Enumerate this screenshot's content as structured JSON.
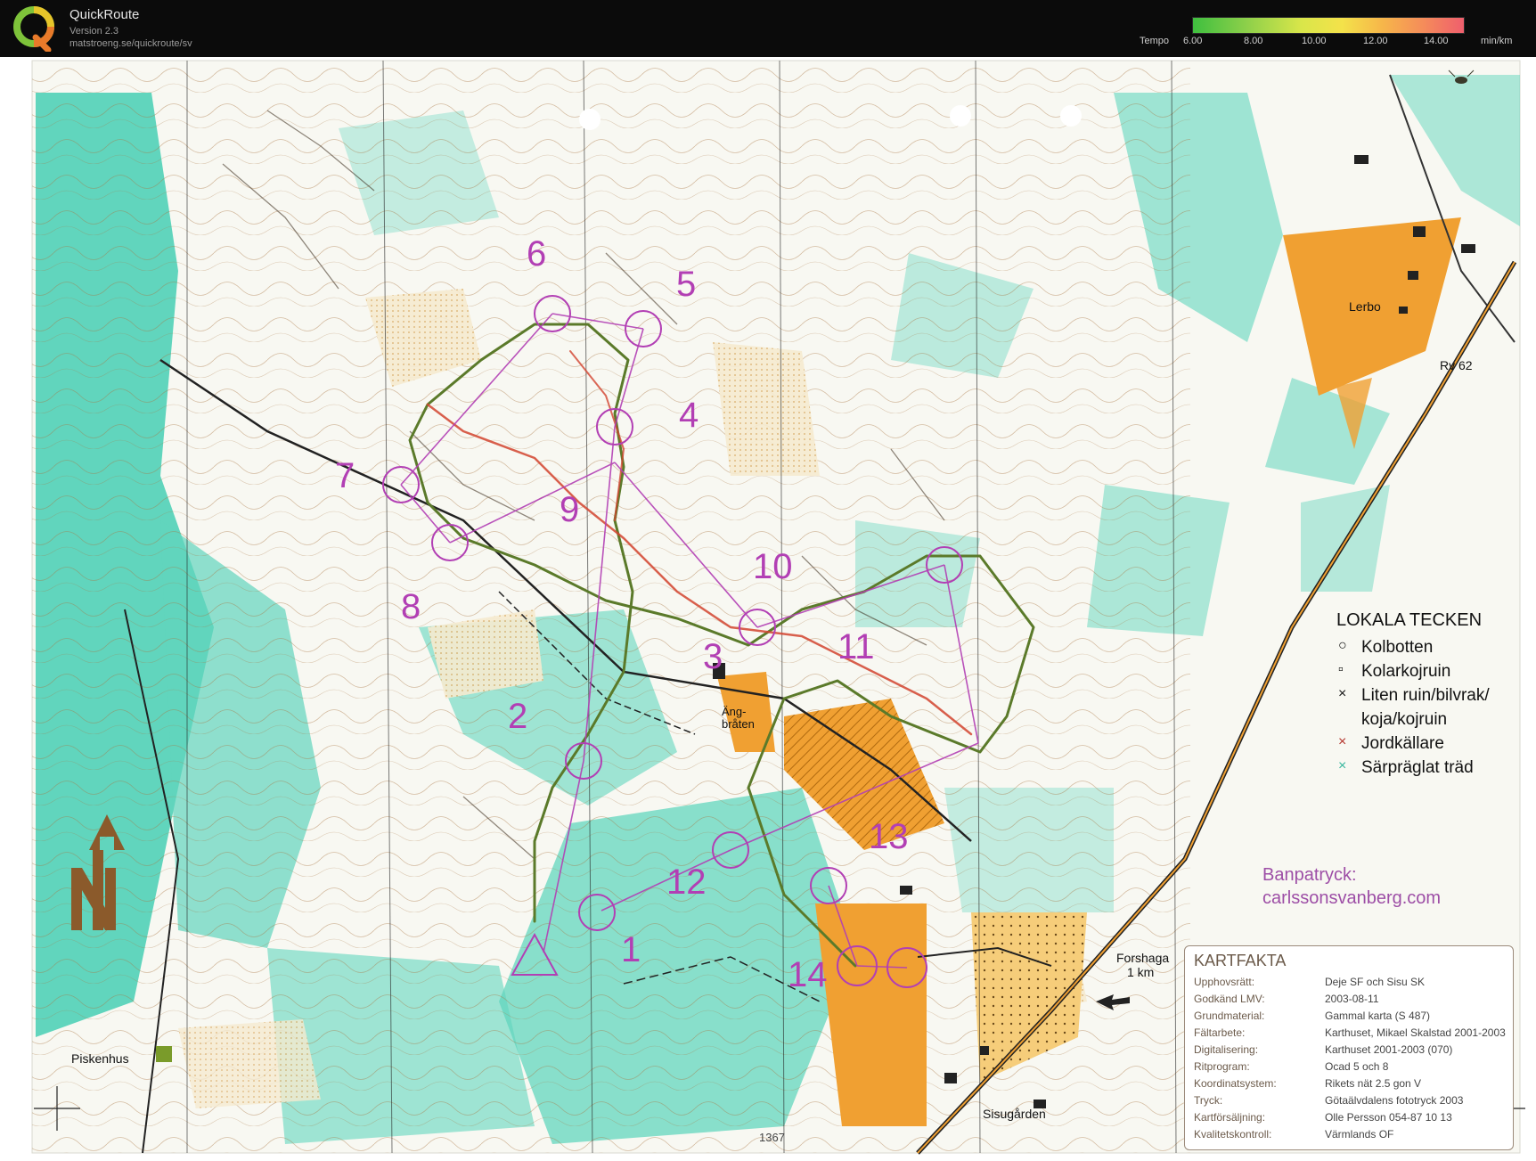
{
  "app": {
    "title": "QuickRoute",
    "version": "Version 2.3",
    "url": "matstroeng.se/quickroute/sv",
    "logo_letter": "Q"
  },
  "tempo": {
    "label": "Tempo",
    "unit": "min/km",
    "ticks": [
      "6.00",
      "8.00",
      "10.00",
      "12.00",
      "14.00"
    ]
  },
  "map": {
    "place_labels": {
      "lerbo": "Lerbo",
      "rv62": "Rv 62",
      "angbraten": "Äng- bråten",
      "piskenhus": "Piskenhus",
      "sisugarden": "Sisugården",
      "forshaga": "Forshaga",
      "forshaga_km": "1 km",
      "map_number": "1367"
    },
    "controls": [
      "1",
      "2",
      "3",
      "4",
      "5",
      "6",
      "7",
      "8",
      "9",
      "10",
      "11",
      "12",
      "13",
      "14"
    ],
    "legend": {
      "title": "LOKALA TECKEN",
      "items": [
        {
          "symbol": "○",
          "label": "Kolbotten"
        },
        {
          "symbol": "▫",
          "label": "Kolarkojruin"
        },
        {
          "symbol": "×",
          "label": "Liten ruin/bilvrak/"
        },
        {
          "symbol": "",
          "label": "koja/kojruin"
        },
        {
          "symbol": "×",
          "label": "Jordkällare"
        },
        {
          "symbol": "×",
          "label": "Särpräglat träd"
        }
      ]
    },
    "print_note": {
      "line1": "Banpatryck:",
      "line2": "carlssonsvanberg.com"
    },
    "kartfakta": {
      "title": "KARTFAKTA",
      "rows": [
        {
          "key": "Upphovsrätt:",
          "value": "Deje SF och Sisu SK"
        },
        {
          "key": "Godkänd LMV:",
          "value": "2003-08-11"
        },
        {
          "key": "Grundmaterial:",
          "value": "Gammal karta (S 487)"
        },
        {
          "key": "Fältarbete:",
          "value": "Karthuset, Mikael Skalstad 2001-2003"
        },
        {
          "key": "Digitalisering:",
          "value": "Karthuset 2001-2003 (070)"
        },
        {
          "key": "Ritprogram:",
          "value": "Ocad 5 och 8"
        },
        {
          "key": "Koordinatsystem:",
          "value": "Rikets nät 2.5 gon V"
        },
        {
          "key": "Tryck:",
          "value": "Götaälvdalens fototryck 2003"
        },
        {
          "key": "Kartförsäljning:",
          "value": "Olle Persson 054-87 10 13"
        },
        {
          "key": "Kvalitetskontroll:",
          "value": "Värmlands OF"
        }
      ]
    },
    "colors": {
      "forest_green": "#46cfb4",
      "open_land": "#f0a032",
      "course": "#b23fb4",
      "route": "#5b7a2a",
      "route_fast": "#d2442f"
    }
  }
}
